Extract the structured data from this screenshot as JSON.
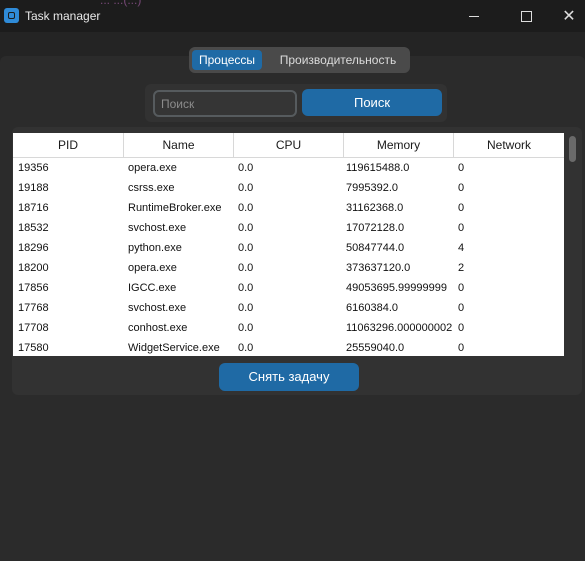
{
  "window": {
    "title": "Task manager",
    "background_partial_text": "... ...(...)",
    "icon": "app-icon"
  },
  "tabs": [
    {
      "label": "Процессы",
      "active": true
    },
    {
      "label": "Производительность",
      "active": false
    }
  ],
  "search": {
    "placeholder": "Поиск",
    "value": "",
    "button_label": "Поиск"
  },
  "table": {
    "columns": [
      "PID",
      "Name",
      "CPU",
      "Memory",
      "Network"
    ],
    "rows": [
      {
        "pid": "19356",
        "name": "opera.exe",
        "cpu": "0.0",
        "memory": "119615488.0",
        "network": "0"
      },
      {
        "pid": "19188",
        "name": "csrss.exe",
        "cpu": "0.0",
        "memory": "7995392.0",
        "network": "0"
      },
      {
        "pid": "18716",
        "name": "RuntimeBroker.exe",
        "cpu": "0.0",
        "memory": "31162368.0",
        "network": "0"
      },
      {
        "pid": "18532",
        "name": "svchost.exe",
        "cpu": "0.0",
        "memory": "17072128.0",
        "network": "0"
      },
      {
        "pid": "18296",
        "name": "python.exe",
        "cpu": "0.0",
        "memory": "50847744.0",
        "network": "4"
      },
      {
        "pid": "18200",
        "name": "opera.exe",
        "cpu": "0.0",
        "memory": "373637120.0",
        "network": "2"
      },
      {
        "pid": "17856",
        "name": "IGCC.exe",
        "cpu": "0.0",
        "memory": "49053695.99999999",
        "network": "0"
      },
      {
        "pid": "17768",
        "name": "svchost.exe",
        "cpu": "0.0",
        "memory": "6160384.0",
        "network": "0"
      },
      {
        "pid": "17708",
        "name": "conhost.exe",
        "cpu": "0.0",
        "memory": "11063296.000000002",
        "network": "0"
      },
      {
        "pid": "17580",
        "name": "WidgetService.exe",
        "cpu": "0.0",
        "memory": "25559040.0",
        "network": "0"
      }
    ]
  },
  "actions": {
    "end_task_label": "Снять задачу"
  },
  "colors": {
    "accent": "#1f6aa5",
    "background": "#242424",
    "panel": "#2b2b2b"
  }
}
